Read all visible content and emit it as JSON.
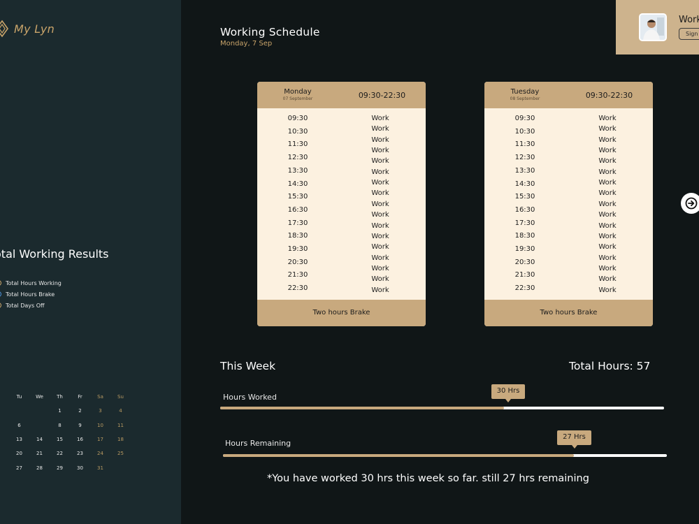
{
  "sidebar": {
    "logo_text": "My Lyn",
    "results_title": "otal Working Results",
    "legend": [
      {
        "label": "Total Hours Working",
        "color": "#c9a46a"
      },
      {
        "label": "Total Hours Brake",
        "color": "#4c8fd6"
      },
      {
        "label": "Total Days Off",
        "color": "#c9a46a"
      }
    ],
    "calendar": {
      "weekdays": [
        "Tu",
        "We",
        "Th",
        "Fr",
        "Sa",
        "Su"
      ],
      "weeks": [
        [
          "",
          "",
          "1",
          "2",
          "3",
          "4"
        ],
        [
          "6",
          "",
          "8",
          "9",
          "10",
          "11"
        ],
        [
          "13",
          "14",
          "15",
          "16",
          "17",
          "18"
        ],
        [
          "20",
          "21",
          "22",
          "23",
          "24",
          "25"
        ],
        [
          "27",
          "28",
          "29",
          "30",
          "31",
          ""
        ]
      ]
    }
  },
  "header": {
    "title": "Working  Schedule",
    "date": "Monday, 7 Sep"
  },
  "profile": {
    "name": "Work",
    "button_label": "Sign Out"
  },
  "schedule": {
    "days": [
      {
        "name": "Monday",
        "date": "07 September",
        "hours": "09:30-22:30",
        "footer": "Two hours Brake",
        "times": [
          "09:30",
          "10:30",
          "11:30",
          "12:30",
          "13:30",
          "14:30",
          "15:30",
          "16:30",
          "17:30",
          "18:30",
          "19:30",
          "20:30",
          "21:30",
          "22:30"
        ],
        "labels": [
          "Work",
          "Work",
          "Work",
          "Work",
          "Work",
          "Work",
          "Work",
          "Work",
          "Work",
          "Work",
          "Work",
          "Work",
          "Work",
          "Work",
          "Work",
          "Work",
          "Work"
        ]
      },
      {
        "name": "Tuesday",
        "date": "08 September",
        "hours": "09:30-22:30",
        "footer": "Two hours Brake",
        "times": [
          "09:30",
          "10:30",
          "11:30",
          "12:30",
          "13:30",
          "14:30",
          "15:30",
          "16:30",
          "17:30",
          "18:30",
          "19:30",
          "20:30",
          "21:30",
          "22:30"
        ],
        "labels": [
          "Work",
          "Work",
          "Work",
          "Work",
          "Work",
          "Work",
          "Work",
          "Work",
          "Work",
          "Work",
          "Work",
          "Work",
          "Work",
          "Work",
          "Work",
          "Work",
          "Work"
        ]
      }
    ]
  },
  "week": {
    "title": "This Week",
    "total_label": "Total Hours: 57",
    "bars": [
      {
        "label": "Hours Worked",
        "value_label": "30 Hrs",
        "fraction": 0.64
      },
      {
        "label": "Hours Remaining",
        "value_label": "27 Hrs",
        "fraction": 0.79
      }
    ],
    "footnote": "*You have worked 30 hrs this week so far. still 27 hrs remaining"
  }
}
